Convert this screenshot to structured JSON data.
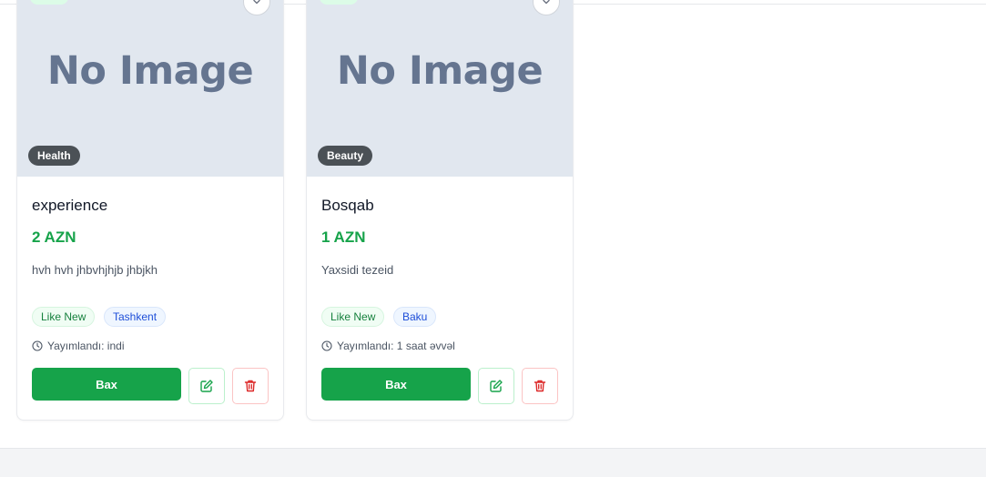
{
  "listings": [
    {
      "image_placeholder": "No Image",
      "category": "Health",
      "title": "experience",
      "price": "2 AZN",
      "description": "hvh hvh jhbvhjhjb jhbjkh",
      "condition": "Like New",
      "location": "Tashkent",
      "posted": "Yayımlandı: indi",
      "view_label": "Bax"
    },
    {
      "image_placeholder": "No Image",
      "category": "Beauty",
      "title": "Bosqab",
      "price": "1 AZN",
      "description": "Yaxsidi tezeid",
      "condition": "Like New",
      "location": "Baku",
      "posted": "Yayımlandı: 1 saat əvvəl",
      "view_label": "Bax"
    }
  ],
  "icons": {
    "favorite": "chevron-down-icon",
    "clock": "clock-icon",
    "edit": "edit-icon",
    "delete": "trash-icon"
  },
  "colors": {
    "accent": "#16a34a",
    "danger": "#dc2626",
    "placeholder_bg": "#e1e7ef",
    "category_badge": "#4b5156"
  }
}
